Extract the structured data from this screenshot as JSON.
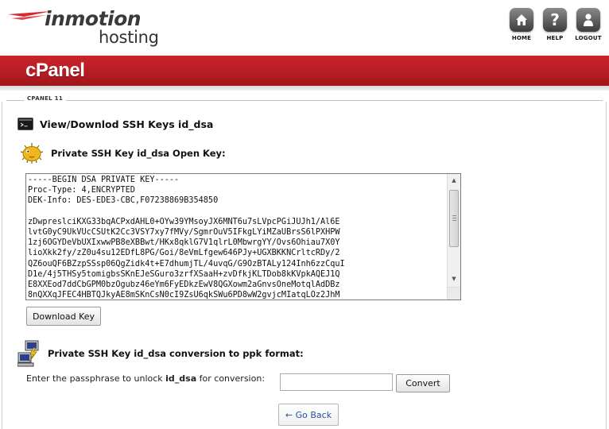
{
  "brand": {
    "logo_top": "inmotion",
    "logo_bottom": "hosting",
    "product": "cPanel"
  },
  "topnav": {
    "home": "HOME",
    "help": "HELP",
    "logout": "LOGOUT"
  },
  "breadcrumb": "CPANEL 11",
  "page": {
    "title": "View/Downlod SSH Keys id_dsa"
  },
  "private_key_section": {
    "title": "Private SSH Key id_dsa Open Key:",
    "key_lines": [
      "-----BEGIN DSA PRIVATE KEY-----",
      "Proc-Type: 4,ENCRYPTED",
      "DEK-Info: DES-EDE3-CBC,F07238869B354850",
      "",
      "zDwpreslciKXG33bqACPxdAHL0+OYw39YMsoyJX6MNT6u7sLVpcPGiJUJh1/Al6E",
      "lvtG0yC9UkVUcCSUtK2Cc3VSY7xy7fMVy/SgmrOuV5IFkgLYiMZaUBrsS6lPXHPW",
      "1zj6OGYDeVbUXIxwwPB8eXBBwt/HKx8qklG7V1qlrL0MbwrgYY/Ovs6Ohiau7X0Y",
      "lioXkk2fy/zZ0u4su12EDfL8PG/Goi/8eVmLfgew646PJy+UGXBKKNCrltcRDy/2",
      "QZ6ouQF6BZzpSSsp06QgZidk4t+E7dhumjTL/4uvqG/G9OzBTALy124Inh6zzCquI",
      "D1e/4j5THSy5tomigbsSKnEJeSGuro3zrfXSaaH+zvDfkjKLTDob8kKVpkAQEJ1Q",
      "E8XXEod7ddCbGPM0bzOgubz46eYm6FyEDkzEwV8QGXowm2aGnvsOneMotqlAdDBz",
      "8nQXXqJFEC4HBTQJkyAE8mSKnCsN0cI9ZsU6qkSWu6PD8wW2gvjcMIatqLOz2JhM"
    ],
    "download_button": "Download Key"
  },
  "ppk_section": {
    "title": "Private SSH Key id_dsa conversion to ppk format:",
    "prompt_before": "Enter the passphrase to unlock ",
    "prompt_key": "id_dsa",
    "prompt_after": " for conversion:",
    "passphrase_value": "",
    "convert_button": "Convert"
  },
  "back_button": "← Go Back",
  "icons": {
    "home": "home-icon",
    "help": "help-icon",
    "logout": "logout-icon",
    "terminal": "terminal-icon",
    "key": "pufferfish-key-icon",
    "convert": "putty-computers-icon"
  },
  "colors": {
    "banner": "#b51d23",
    "link": "#2a4fa0"
  }
}
